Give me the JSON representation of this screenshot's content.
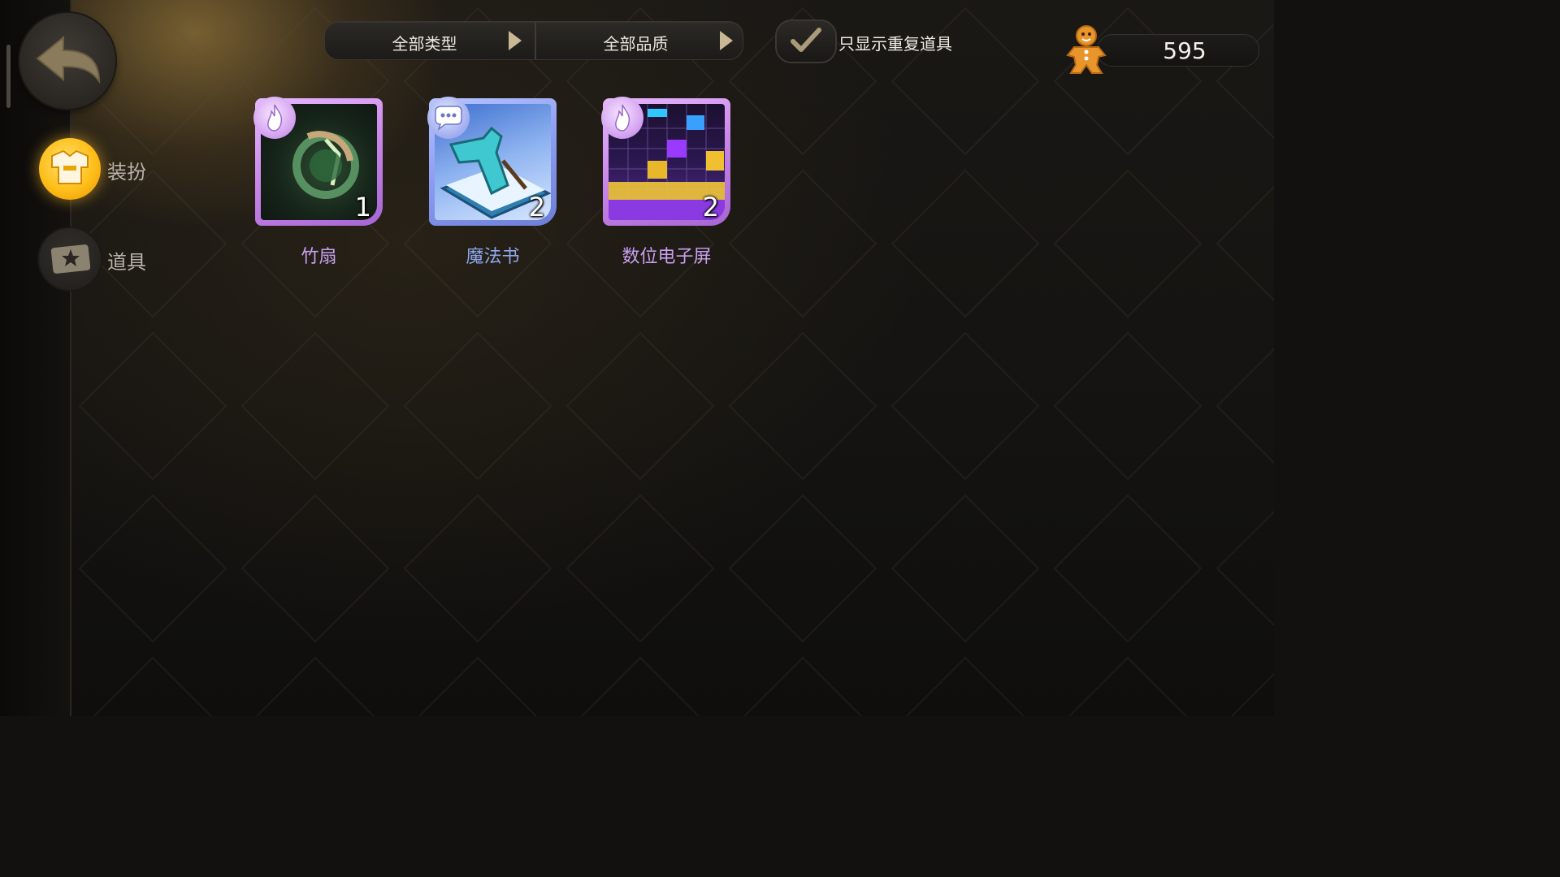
{
  "filters": {
    "type_label": "全部类型",
    "quality_label": "全部品质"
  },
  "toggle": {
    "label": "只显示重复道具",
    "checked": true
  },
  "currency": {
    "icon": "gingerbread-icon",
    "value": "595"
  },
  "sidebar": {
    "items": [
      {
        "label": "装扮",
        "icon": "outfit-icon",
        "active": true
      },
      {
        "label": "道具",
        "icon": "item-ticket-icon",
        "active": false
      }
    ]
  },
  "items": [
    {
      "name": "竹扇",
      "count": "1",
      "badge": "flame-icon",
      "name_color": "#c9a0f0",
      "frame": "#c886e8"
    },
    {
      "name": "魔法书",
      "count": "2",
      "badge": "chat-bubble-icon",
      "name_color": "#8ea8ee",
      "frame": "#8b9bf0"
    },
    {
      "name": "数位电子屏",
      "count": "2",
      "badge": "flame-icon",
      "name_color": "#c9a0f0",
      "frame": "#c886e8"
    }
  ],
  "colors": {
    "accent_gold": "#ffbf1a",
    "purple_frame": "#c886e8",
    "blue_frame": "#8b9bf0"
  }
}
